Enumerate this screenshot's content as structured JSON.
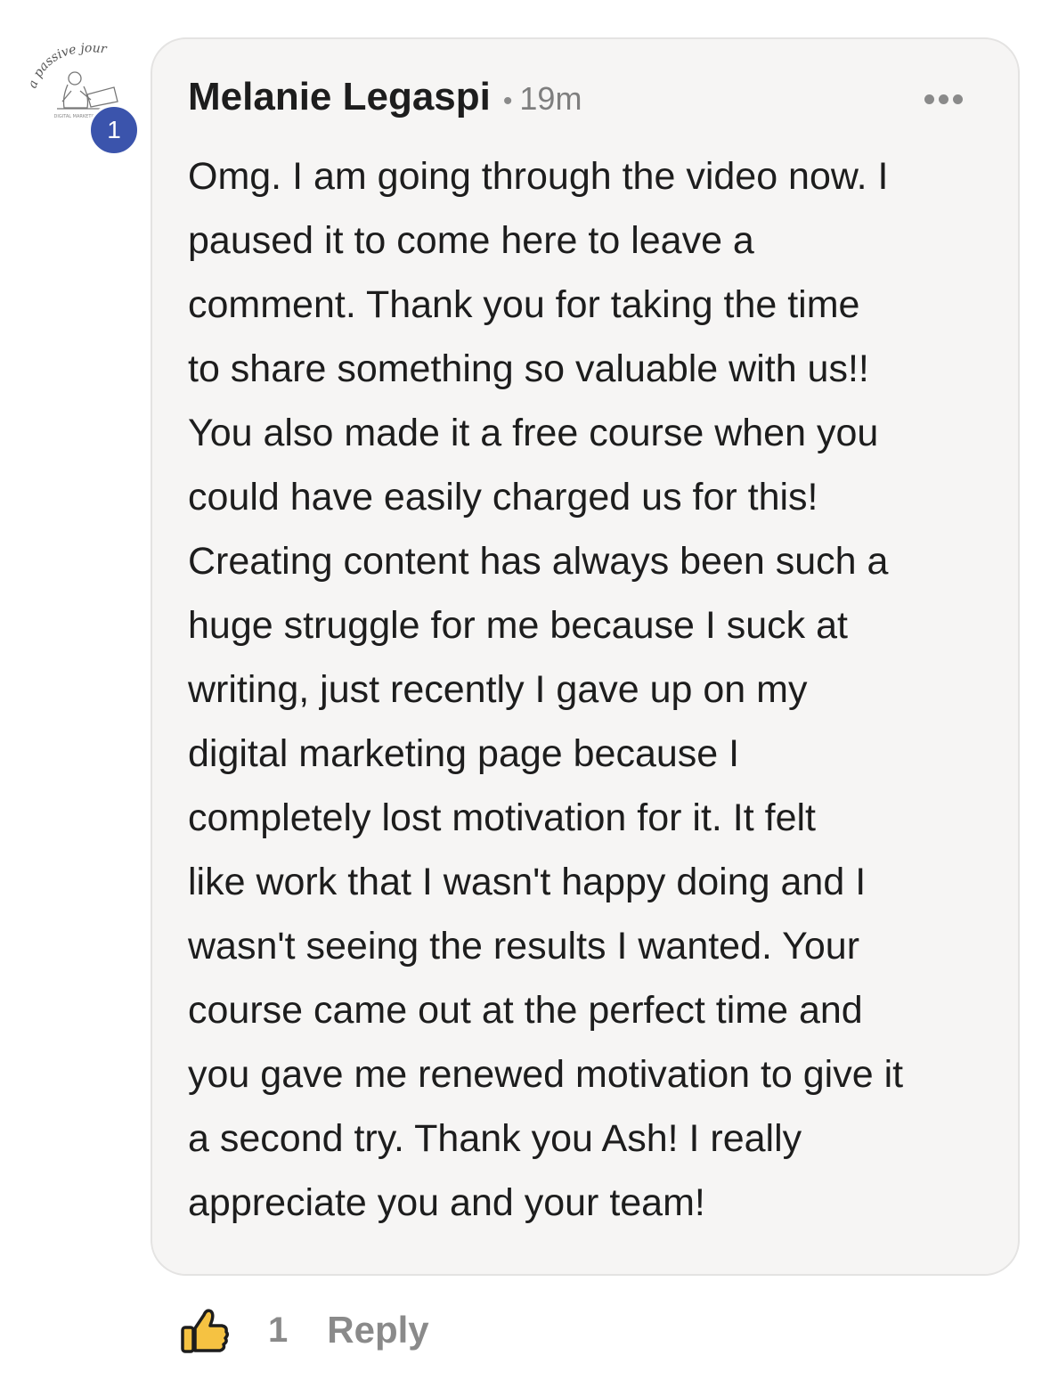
{
  "comment": {
    "author": "Melanie Legaspi",
    "separator": "•",
    "timestamp": "19m",
    "avatar_text": "a passive journey",
    "avatar_subtext": "DIGITAL MARKETING",
    "badge_count": "1",
    "lines": [
      "Omg. I am going through the video now. I",
      "paused it to come here to leave a",
      "comment. Thank you for taking the time",
      "to share something so valuable with us!!",
      "You also made it a free course when you",
      "could have easily charged us for this!",
      "Creating content has always been such a",
      "huge struggle for me because I suck at",
      "writing, just recently I gave up on my",
      "digital marketing page because I",
      "completely lost motivation for it. It felt",
      "like work that I wasn't happy doing and I",
      "wasn't seeing the results I wanted. Your",
      "course came out at the perfect time and",
      "you gave me renewed motivation to give it",
      "a second try. Thank you Ash! I really",
      "appreciate you and your team!"
    ]
  },
  "actions": {
    "like_icon": "thumbs-up-icon",
    "like_count": "1",
    "reply_label": "Reply"
  },
  "colors": {
    "badge": "#3b54ac",
    "bubble": "#f6f5f4",
    "like_fill": "#f5c242",
    "muted": "#8a8a8a"
  }
}
